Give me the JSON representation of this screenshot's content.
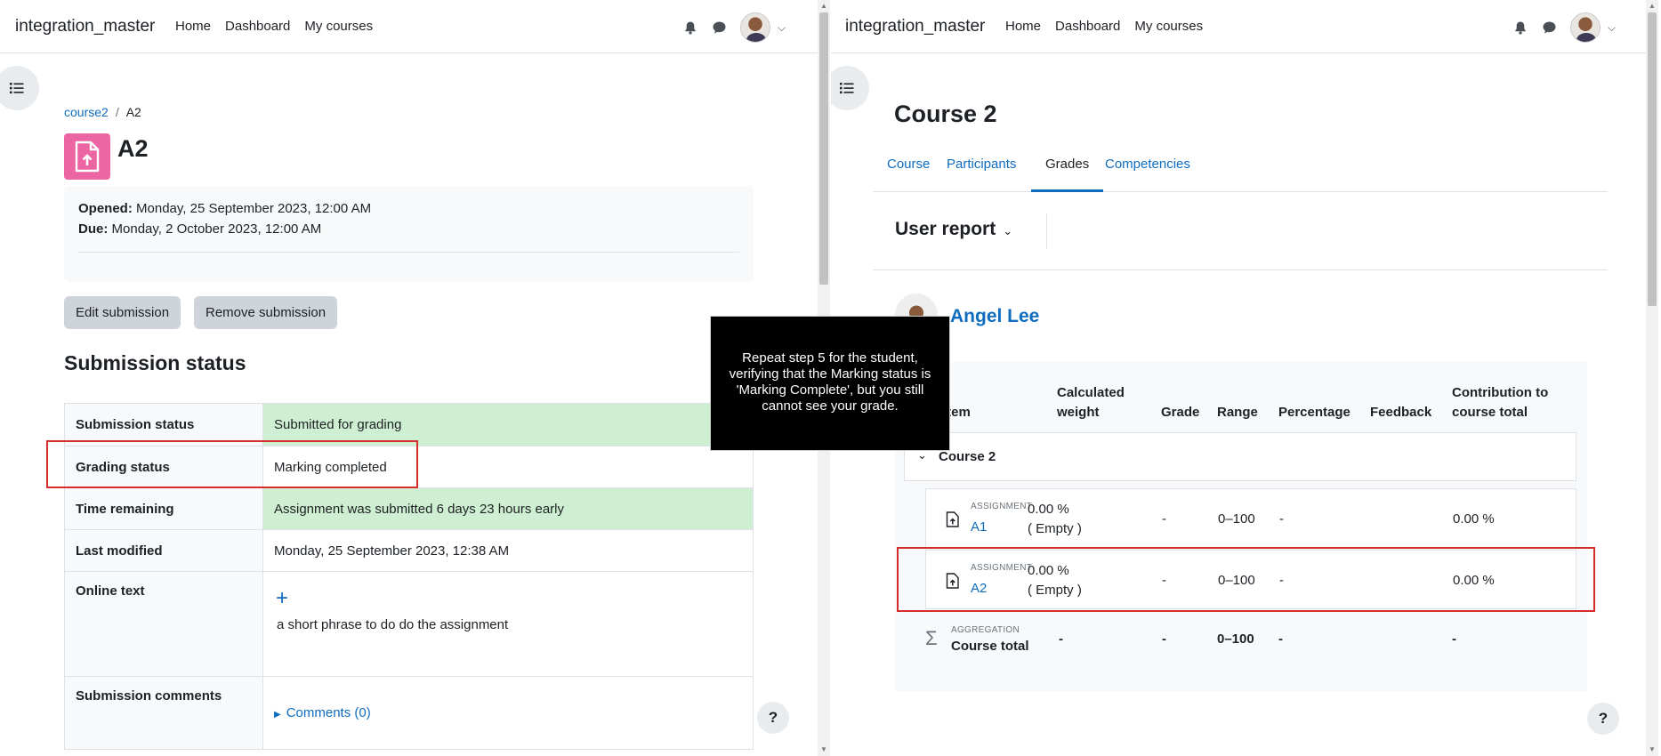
{
  "left": {
    "brand": "integration_master",
    "nav": [
      "Home",
      "Dashboard",
      "My courses"
    ],
    "breadcrumb": {
      "course": "course2",
      "page": "A2"
    },
    "title": "A2",
    "opened_label": "Opened:",
    "opened_value": "Monday, 25 September 2023, 12:00 AM",
    "due_label": "Due:",
    "due_value": "Monday, 2 October 2023, 12:00 AM",
    "buttons": {
      "edit": "Edit submission",
      "remove": "Remove submission"
    },
    "section_title": "Submission status",
    "rows": [
      {
        "key": "Submission status",
        "value": "Submitted for grading"
      },
      {
        "key": "Grading status",
        "value": "Marking completed"
      },
      {
        "key": "Time remaining",
        "value": "Assignment was submitted 6 days 23 hours early"
      },
      {
        "key": "Last modified",
        "value": "Monday, 25 September 2023, 12:38 AM"
      },
      {
        "key": "Online text",
        "value": "a short phrase to do do the assignment",
        "icon": "+"
      },
      {
        "key": "Submission comments",
        "value": "Comments (0)"
      }
    ],
    "help": "?"
  },
  "tooltip": "Repeat step 5 for the student, verifying that the Marking status is 'Marking Complete', but you still cannot see your grade.",
  "right": {
    "brand": "integration_master",
    "nav": [
      "Home",
      "Dashboard",
      "My courses"
    ],
    "course_title": "Course 2",
    "tabs": [
      "Course",
      "Participants",
      "Grades",
      "Competencies"
    ],
    "report_label": "User report",
    "user_name": "Angel Lee",
    "headers": {
      "item": "item",
      "weight": [
        "Calculated",
        "weight"
      ],
      "grade": "Grade",
      "range": "Range",
      "percentage": "Percentage",
      "feedback": "Feedback",
      "contribution": [
        "Contribution to",
        "course total"
      ]
    },
    "category": "Course 2",
    "items": [
      {
        "type": "ASSIGNMENT",
        "name": "A1",
        "weight": "0.00 %",
        "weight_note": "( Empty )",
        "grade": "-",
        "range": "0–100",
        "percentage": "-",
        "contribution": "0.00 %"
      },
      {
        "type": "ASSIGNMENT",
        "name": "A2",
        "weight": "0.00 %",
        "weight_note": "( Empty )",
        "grade": "-",
        "range": "0–100",
        "percentage": "-",
        "contribution": "0.00 %"
      }
    ],
    "total": {
      "type": "AGGREGATION",
      "name": "Course total",
      "weight": "-",
      "grade": "-",
      "range": "0–100",
      "percentage": "-",
      "contribution": "-"
    },
    "help": "?"
  }
}
